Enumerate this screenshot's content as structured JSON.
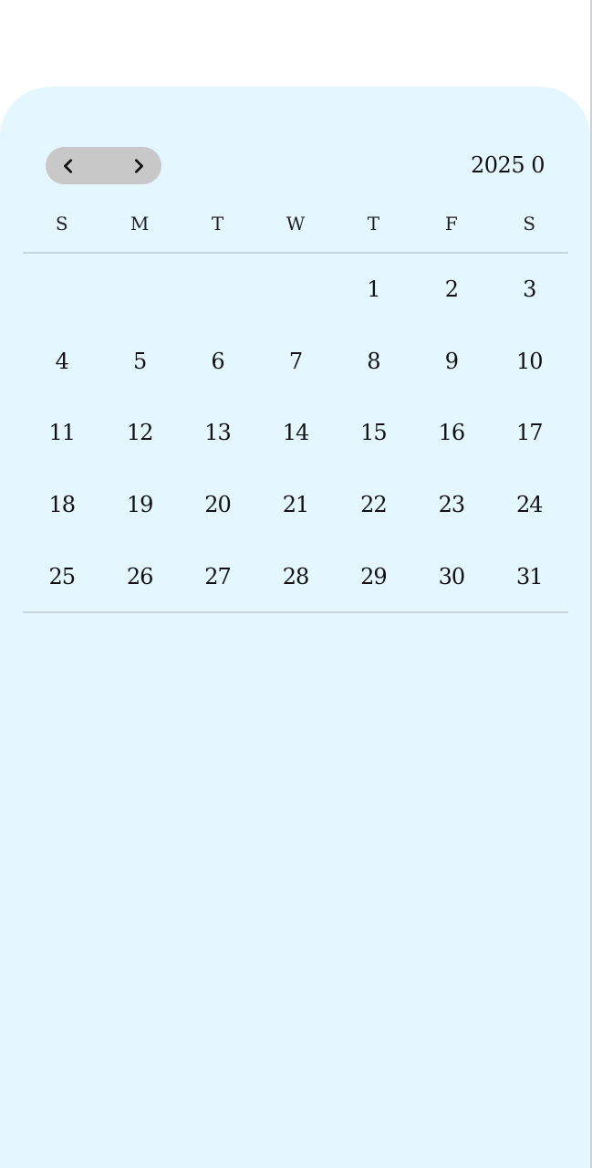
{
  "header": {
    "month_title": "2025 0",
    "prev_label": "previous month",
    "next_label": "next month"
  },
  "weekdays": [
    "S",
    "M",
    "T",
    "W",
    "T",
    "F",
    "S"
  ],
  "days": [
    "",
    "",
    "",
    "",
    "1",
    "2",
    "3",
    "4",
    "5",
    "6",
    "7",
    "8",
    "9",
    "10",
    "11",
    "12",
    "13",
    "14",
    "15",
    "16",
    "17",
    "18",
    "19",
    "20",
    "21",
    "22",
    "23",
    "24",
    "25",
    "26",
    "27",
    "28",
    "29",
    "30",
    "31"
  ],
  "colors": {
    "card_background": "#e4f7fe",
    "nav_pill": "#c8c8c8",
    "divider": "#c6d6dc",
    "text": "#111111"
  }
}
